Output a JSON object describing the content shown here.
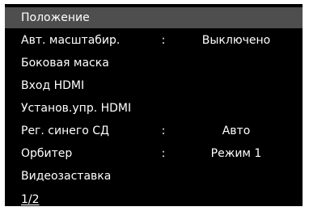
{
  "menu": {
    "items": [
      {
        "label": "Положение",
        "colon": "",
        "value": "",
        "selected": true
      },
      {
        "label": "Авт. масштабир.",
        "colon": ":",
        "value": "Выключено",
        "selected": false
      },
      {
        "label": "Боковая  маска",
        "colon": "",
        "value": "",
        "selected": false
      },
      {
        "label": "Вход  HDMI",
        "colon": "",
        "value": "",
        "selected": false
      },
      {
        "label": "Установ.упр. HDMI",
        "colon": "",
        "value": "",
        "selected": false
      },
      {
        "label": "Рег. синего СД",
        "colon": ":",
        "value": "Авто",
        "selected": false
      },
      {
        "label": "Орбитер",
        "colon": ":",
        "value": "Режим 1",
        "selected": false
      },
      {
        "label": "Видеозаставка",
        "colon": "",
        "value": "",
        "selected": false
      }
    ],
    "page_indicator": "1/2"
  },
  "colors": {
    "background": "#000000",
    "highlight": "#4e4e4e",
    "text": "#ffffff"
  }
}
